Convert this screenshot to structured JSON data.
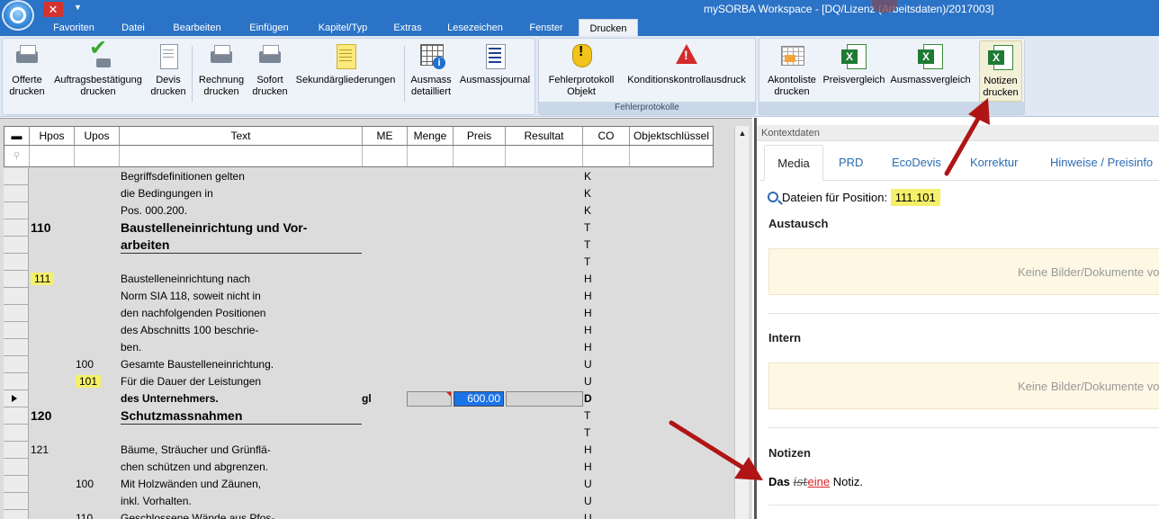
{
  "window": {
    "title": "mySORBA Workspace - [DQ/Lizenz (Arbeitsdaten)/2017003]",
    "close_glyph": "✕",
    "qat_arrow": "▼"
  },
  "ribbon_tabs": [
    "Favoriten",
    "Datei",
    "Bearbeiten",
    "Einfügen",
    "Kapitel/Typ",
    "Extras",
    "Lesezeichen",
    "Fenster",
    "Drucken"
  ],
  "ribbon": {
    "buttons": [
      {
        "label": "Offerte\ndrucken",
        "icon": "printer-icon"
      },
      {
        "label": "Auftragsbestätigung\ndrucken",
        "icon": "check-print-icon"
      },
      {
        "label": "Devis\ndrucken",
        "icon": "document-icon"
      },
      {
        "label": "Rechnung\ndrucken",
        "icon": "printer-icon"
      },
      {
        "label": "Sofort\ndrucken",
        "icon": "printer-icon"
      },
      {
        "label": "Sekundärgliederungen",
        "icon": "yellow-note-icon"
      },
      {
        "label": "Ausmass\ndetailliert",
        "icon": "grid-info-icon"
      },
      {
        "label": "Ausmassjournal",
        "icon": "list-icon"
      },
      {
        "label": "Fehlerprotokoll\nObjekt",
        "icon": "shield-warning-icon"
      },
      {
        "label": "Konditionskontrollausdruck",
        "icon": "warning-icon"
      },
      {
        "label": "Akontoliste\ndrucken",
        "icon": "sheet-icon"
      },
      {
        "label": "Preisvergleich",
        "icon": "excel-icon"
      },
      {
        "label": "Ausmassvergleich",
        "icon": "excel-icon"
      },
      {
        "label": "Notizen\ndrucken",
        "icon": "excel-icon"
      }
    ],
    "group_label_fehler": "Fehlerprotokolle"
  },
  "grid": {
    "columns": [
      "Hpos",
      "Upos",
      "Text",
      "ME",
      "Menge",
      "Preis",
      "Resultat",
      "CO",
      "Objektschlüssel"
    ],
    "header_glyph": "▬",
    "filter_glyph": "⚲",
    "rows": [
      {
        "hpos": "",
        "upos": "",
        "text": "Begriffsdefinitionen gelten",
        "co": "K"
      },
      {
        "hpos": "",
        "upos": "",
        "text": "die Bedingungen in",
        "co": "K"
      },
      {
        "hpos": "",
        "upos": "",
        "text": "Pos. 000.200.",
        "co": "K"
      },
      {
        "hpos": "110",
        "upos": "",
        "text": "Baustelleneinrichtung und Vor-",
        "co": "T"
      },
      {
        "hpos": "",
        "upos": "",
        "text": "arbeiten",
        "co": "T"
      },
      {
        "hpos": "",
        "upos": "",
        "text": "",
        "co": "T"
      },
      {
        "hpos": "111",
        "upos": "",
        "text": "Baustelleneinrichtung nach",
        "co": "H"
      },
      {
        "hpos": "",
        "upos": "",
        "text": "Norm SIA 118, soweit nicht in",
        "co": "H"
      },
      {
        "hpos": "",
        "upos": "",
        "text": "den nachfolgenden Positionen",
        "co": "H"
      },
      {
        "hpos": "",
        "upos": "",
        "text": "des Abschnitts 100 beschrie-",
        "co": "H"
      },
      {
        "hpos": "",
        "upos": "",
        "text": "ben.",
        "co": "H"
      },
      {
        "hpos": "",
        "upos": "100",
        "text": "Gesamte Baustelleneinrichtung.",
        "co": "U"
      },
      {
        "hpos": "",
        "upos": "101",
        "text": "Für die Dauer der Leistungen",
        "co": "U"
      },
      {
        "hpos": "",
        "upos": "",
        "text": "des Unternehmers.",
        "me": "gl",
        "preis": "600.00",
        "co": "D"
      },
      {
        "hpos": "120",
        "upos": "",
        "text": "Schutzmassnahmen",
        "co": "T"
      },
      {
        "hpos": "",
        "upos": "",
        "text": "",
        "co": "T"
      },
      {
        "hpos": "121",
        "upos": "",
        "text": "Bäume, Sträucher und Grünflä-",
        "co": "H"
      },
      {
        "hpos": "",
        "upos": "",
        "text": "chen schützen und abgrenzen.",
        "co": "H"
      },
      {
        "hpos": "",
        "upos": "100",
        "text": "Mit Holzwänden und Zäunen,",
        "co": "U"
      },
      {
        "hpos": "",
        "upos": "",
        "text": "inkl. Vorhalten.",
        "co": "U"
      },
      {
        "hpos": "",
        "upos": "110",
        "text": "Geschlossene Wände aus Pfos-",
        "co": "U"
      }
    ]
  },
  "context": {
    "header": "Kontextdaten",
    "tabs": [
      "Media",
      "PRD",
      "EcoDevis",
      "Korrektur",
      "Hinweise / Preisinfo"
    ],
    "file_label": "Dateien für Position:",
    "file_value": "111.101",
    "austausch_title": "Austausch",
    "austausch_empty": "Keine Bilder/Dokumente vorhanden",
    "intern_title": "Intern",
    "intern_empty": "Keine Bilder/Dokumente vorhanden",
    "notizen_title": "Notizen",
    "note_bold": "Das",
    "note_strike": "ist",
    "note_insert": "eine",
    "note_rest": "Notiz."
  },
  "colors": {
    "titlebar": "#2b73c6",
    "highlight": "#f4f06a",
    "selected_cell": "#1a73e8",
    "annotation_arrow": "#b01515"
  }
}
